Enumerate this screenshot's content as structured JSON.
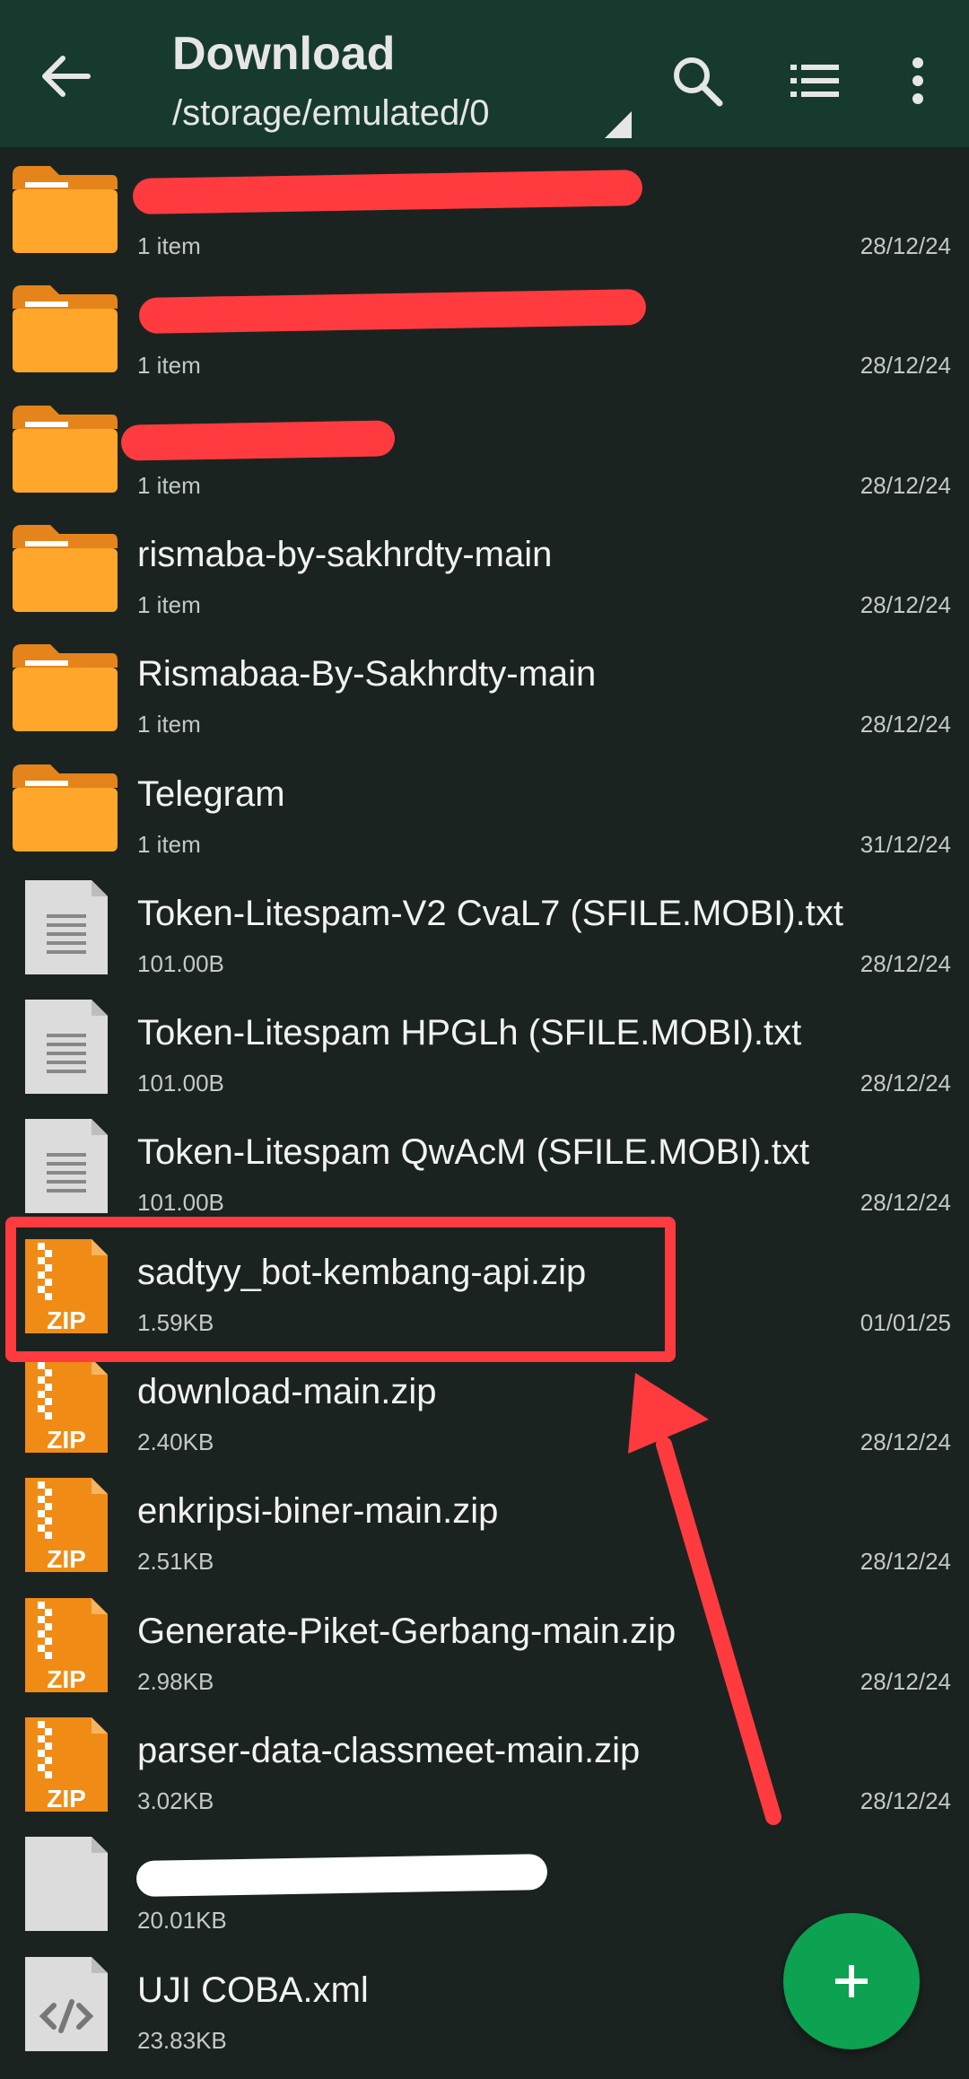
{
  "header": {
    "title": "Download",
    "path": "/storage/emulated/0",
    "back_icon": "arrow-left-icon",
    "actions": [
      "search-icon",
      "list-view-icon",
      "more-vert-icon"
    ]
  },
  "colors": {
    "appbar": "#163a2d",
    "background": "#1b2321",
    "folder": "#ffa62b",
    "zip": "#f08c15",
    "highlight": "#ff3b3f",
    "fab": "#0ca251"
  },
  "files": [
    {
      "name": "",
      "sub": "1 item",
      "date": "28/12/24",
      "type": "folder"
    },
    {
      "name": "",
      "sub": "1 item",
      "date": "28/12/24",
      "type": "folder"
    },
    {
      "name": "",
      "sub": "1 item",
      "date": "28/12/24",
      "type": "folder"
    },
    {
      "name": "rismaba-by-sakhrdty-main",
      "sub": "1 item",
      "date": "28/12/24",
      "type": "folder"
    },
    {
      "name": "Rismabaa-By-Sakhrdty-main",
      "sub": "1 item",
      "date": "28/12/24",
      "type": "folder"
    },
    {
      "name": "Telegram",
      "sub": "1 item",
      "date": "31/12/24",
      "type": "folder"
    },
    {
      "name": "Token-Litespam-V2 CvaL7 (SFILE.MOBI).txt",
      "sub": "101.00B",
      "date": "28/12/24",
      "type": "text"
    },
    {
      "name": "Token-Litespam HPGLh (SFILE.MOBI).txt",
      "sub": "101.00B",
      "date": "28/12/24",
      "type": "text"
    },
    {
      "name": "Token-Litespam QwAcM (SFILE.MOBI).txt",
      "sub": "101.00B",
      "date": "28/12/24",
      "type": "text"
    },
    {
      "name": "sadtyy_bot-kembang-api.zip",
      "sub": "1.59KB",
      "date": "01/01/25",
      "type": "zip"
    },
    {
      "name": "download-main.zip",
      "sub": "2.40KB",
      "date": "28/12/24",
      "type": "zip"
    },
    {
      "name": "enkripsi-biner-main.zip",
      "sub": "2.51KB",
      "date": "28/12/24",
      "type": "zip"
    },
    {
      "name": "Generate-Piket-Gerbang-main.zip",
      "sub": "2.98KB",
      "date": "28/12/24",
      "type": "zip"
    },
    {
      "name": "parser-data-classmeet-main.zip",
      "sub": "3.02KB",
      "date": "28/12/24",
      "type": "zip"
    },
    {
      "name": "",
      "sub": "20.01KB",
      "date": "",
      "type": "generic"
    },
    {
      "name": "UJI COBA.xml",
      "sub": "23.83KB",
      "date": "",
      "type": "code"
    }
  ],
  "zip_label": "ZIP",
  "fab_icon": "plus-icon"
}
